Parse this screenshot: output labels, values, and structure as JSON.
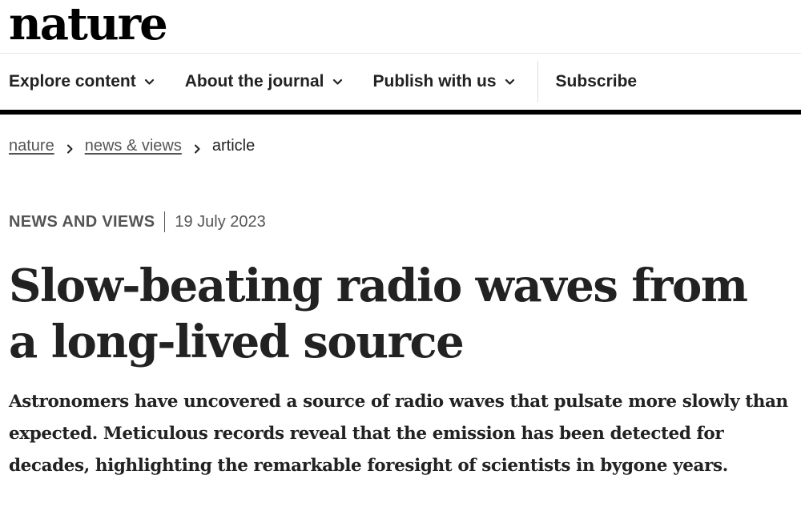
{
  "site": {
    "logo": "nature"
  },
  "nav": {
    "items": [
      {
        "label": "Explore content",
        "has_dropdown": true
      },
      {
        "label": "About the journal",
        "has_dropdown": true
      },
      {
        "label": "Publish with us",
        "has_dropdown": true
      }
    ],
    "subscribe": "Subscribe"
  },
  "breadcrumb": {
    "items": [
      {
        "label": "nature",
        "link": true
      },
      {
        "label": "news & views",
        "link": true
      },
      {
        "label": "article",
        "link": false
      }
    ]
  },
  "article": {
    "type": "NEWS AND VIEWS",
    "date": "19 July 2023",
    "title": "Slow-beating radio waves from a long-lived source",
    "standfirst": "Astronomers have uncovered a source of radio waves that pulsate more slowly than expected. Meticulous records reveal that the emission has been detected for decades, highlighting the remarkable foresight of scientists in bygone years."
  },
  "icons": {
    "nav_dropdown": "chevron-down-icon",
    "breadcrumb_separator": "chevron-right-icon"
  }
}
